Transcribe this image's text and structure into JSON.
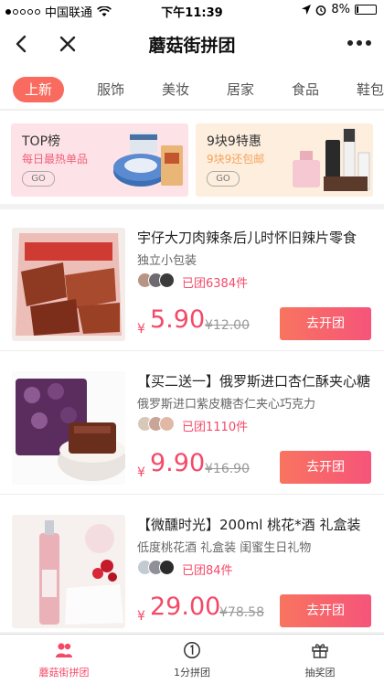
{
  "status_bar": {
    "carrier": "中国联通",
    "time": "下午11:39",
    "battery": "8%",
    "battery_level": 0.08
  },
  "navbar": {
    "title": "蘑菇街拼团"
  },
  "tabs": [
    "上新",
    "服饰",
    "美妆",
    "居家",
    "食品",
    "鞋包"
  ],
  "banners": [
    {
      "title": "TOP榜",
      "subtitle": "每日最热单品",
      "go": "GO"
    },
    {
      "title": "9块9特惠",
      "subtitle": "9块9还包邮",
      "go": "GO"
    }
  ],
  "products": [
    {
      "name": "宇仔大刀肉辣条后儿时怀旧辣片零食",
      "sub": "独立小包装",
      "joined": "已团6384件",
      "yen": "¥",
      "price": "5.90",
      "orig": "¥12.00",
      "button": "去开团"
    },
    {
      "name": "【买二送一】俄罗斯进口杏仁酥夹心糖",
      "sub": "俄罗斯进口紫皮糖杏仁夹心巧克力",
      "joined": "已团1110件",
      "yen": "¥",
      "price": "9.90",
      "orig": "¥16.90",
      "button": "去开团"
    },
    {
      "name": "【微醺时光】200ml 桃花*酒 礼盒装",
      "sub": "低度桃花酒 礼盒装 闺蜜生日礼物",
      "joined": "已团84件",
      "yen": "¥",
      "price": "29.00",
      "orig": "¥78.58",
      "button": "去开团"
    }
  ],
  "bottom_tabs": [
    "蘑菇街拼团",
    "1分拼团",
    "抽奖团"
  ],
  "colors": {
    "accent": "#f44a68",
    "tab_active": "#f86b5e",
    "button_start": "#f8745f",
    "button_end": "#f6547a"
  }
}
